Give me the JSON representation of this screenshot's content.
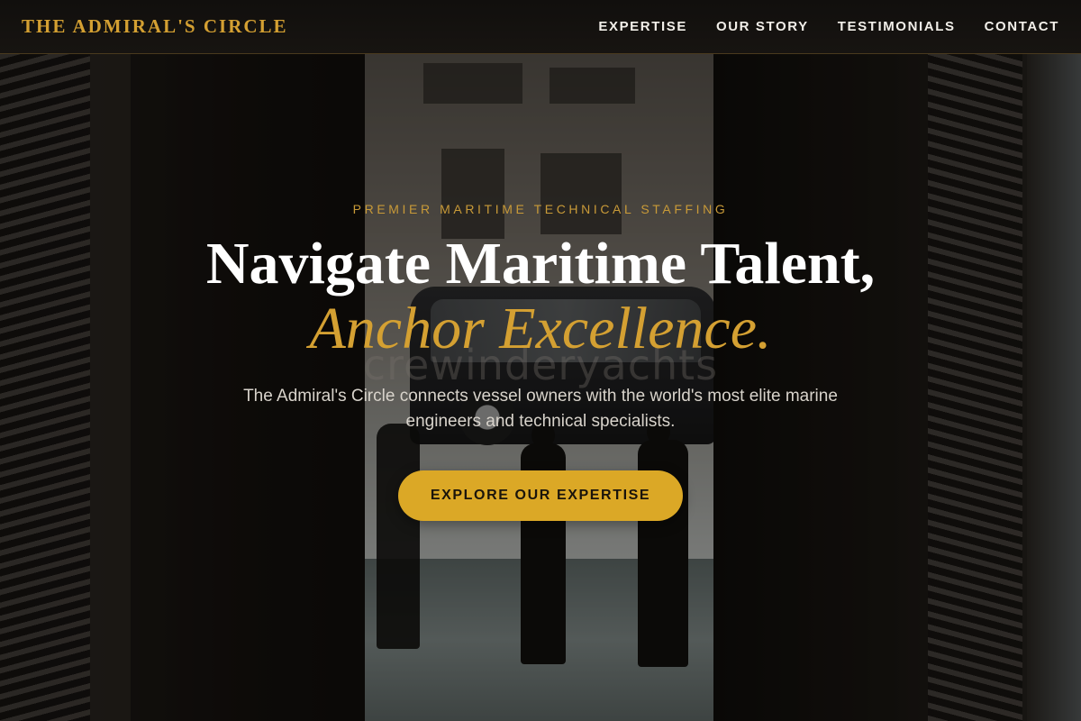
{
  "brand": {
    "name": "THE ADMIRAL'S CIRCLE"
  },
  "nav": {
    "items": [
      {
        "label": "EXPERTISE"
      },
      {
        "label": "OUR STORY"
      },
      {
        "label": "TESTIMONIALS"
      },
      {
        "label": "CONTACT"
      }
    ]
  },
  "hero": {
    "eyebrow": "PREMIER MARITIME TECHNICAL STAFFING",
    "headline": "Navigate Maritime Talent,",
    "headline_accent": "Anchor Excellence.",
    "watermark": "crewinderyachts",
    "subtitle": "The Admiral's Circle connects vessel owners with the world's most elite marine engineers and technical specialists.",
    "cta_label": "EXPLORE OUR EXPERTISE",
    "background_image": "dark doorway opening onto a city street with a black van and silhouetted people"
  },
  "colors": {
    "accent": "#d4a032",
    "button": "#dba826",
    "nav_bg": "#12100e",
    "text": "#ffffff"
  }
}
